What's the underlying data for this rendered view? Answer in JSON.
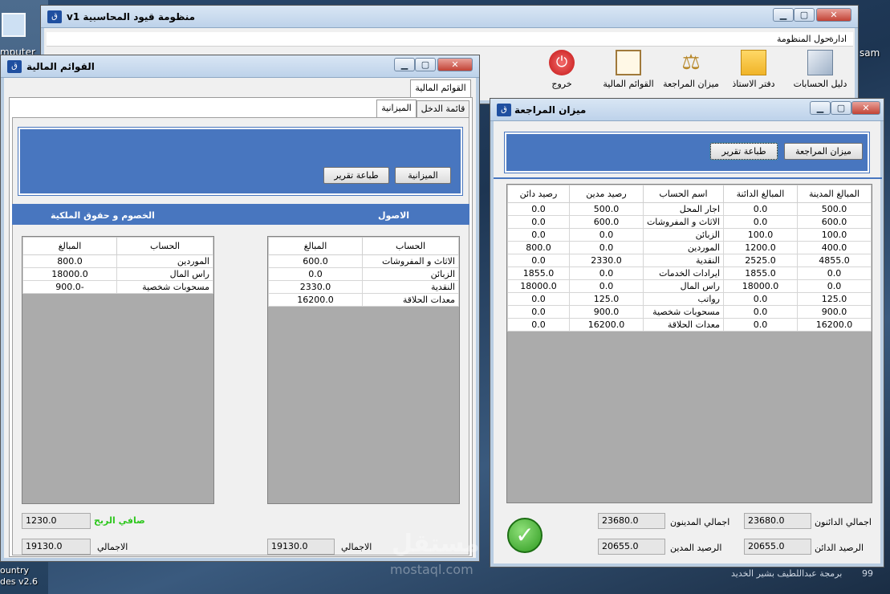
{
  "desktop": {
    "computer_label": "mputer",
    "bottom_label_1": "ountry",
    "bottom_label_2": "des v2.6",
    "right_label": "sam",
    "footer_text": "برمجة عبداللطيف بشير الخديد",
    "footer_num": "99",
    "watermark": "مستقل",
    "watermark_sub": "mostaql.com"
  },
  "main_window": {
    "title": "منظومة قيود المحاسبية v1",
    "menu": [
      "ادارة",
      "حول المنظومة"
    ],
    "toolbar": [
      {
        "label": "دليل الحسابات",
        "icon": "documents-icon"
      },
      {
        "label": "دفتر الاستاذ",
        "icon": "folder-icon"
      },
      {
        "label": "ميزان المراجعة",
        "icon": "scales-icon"
      },
      {
        "label": "القوائم المالية",
        "icon": "clipboard-icon"
      },
      {
        "label": "خروج",
        "icon": "power-icon"
      }
    ]
  },
  "fin_window": {
    "title": "القوائم المالية",
    "outer_tab": "القوائم المالية",
    "tabs": [
      "قائمة الدخل",
      "الميزانية"
    ],
    "btn_balance": "الميزانية",
    "btn_print": "طباعة تقرير",
    "section_assets": "الاصول",
    "section_liab": "الخصوم و حقوق الملكية",
    "assets_headers": [
      "الحساب",
      "المبالغ"
    ],
    "assets_rows": [
      [
        "الاثاث و المفروشات",
        "600.0"
      ],
      [
        "الزبائن",
        "0.0"
      ],
      [
        "النقدية",
        "2330.0"
      ],
      [
        "معدات الحلاقة",
        "16200.0"
      ]
    ],
    "liab_headers": [
      "الحساب",
      "المبالغ"
    ],
    "liab_rows": [
      [
        "الموردين",
        "800.0"
      ],
      [
        "راس المال",
        "18000.0"
      ],
      [
        "مسحوبات شخصية",
        "-900.0"
      ]
    ],
    "net_profit_label": "صافي الربح",
    "net_profit": "1230.0",
    "total_label_left": "الاجمالي",
    "total_left": "19130.0",
    "total_label_right": "الاجمالي",
    "total_right": "19130.0"
  },
  "trial_window": {
    "title": "ميزان المراجعة",
    "btn_trial": "ميزان المراجعة",
    "btn_print": "طباعة تقرير",
    "headers": [
      "المبالغ المدينة",
      "المبالغ الدائنة",
      "اسم الحساب",
      "رصيد مدين",
      "رصيد دائن"
    ],
    "rows": [
      [
        "500.0",
        "0.0",
        "اجار المحل",
        "500.0",
        "0.0"
      ],
      [
        "600.0",
        "0.0",
        "الاثاث و المفروشات",
        "600.0",
        "0.0"
      ],
      [
        "100.0",
        "100.0",
        "الزبائن",
        "0.0",
        "0.0"
      ],
      [
        "400.0",
        "1200.0",
        "الموردين",
        "0.0",
        "800.0"
      ],
      [
        "4855.0",
        "2525.0",
        "النقدية",
        "2330.0",
        "0.0"
      ],
      [
        "0.0",
        "1855.0",
        "ايرادات الخدمات",
        "0.0",
        "1855.0"
      ],
      [
        "0.0",
        "18000.0",
        "راس المال",
        "0.0",
        "18000.0"
      ],
      [
        "125.0",
        "0.0",
        "رواتب",
        "125.0",
        "0.0"
      ],
      [
        "900.0",
        "0.0",
        "مسحوبات شخصية",
        "900.0",
        "0.0"
      ],
      [
        "16200.0",
        "0.0",
        "معدات الحلاقة",
        "16200.0",
        "0.0"
      ]
    ],
    "total_credit_label": "اجمالي الدائنون",
    "total_credit": "23680.0",
    "total_debit_label": "اجمالي المدينون",
    "total_debit": "23680.0",
    "credit_balance_label": "الرصيد الدائن",
    "credit_balance": "20655.0",
    "debit_balance_label": "الرصيد المدين",
    "debit_balance": "20655.0"
  },
  "colors": {
    "accent_blue": "#4876bf",
    "net_profit_green": "#2ec71e"
  }
}
